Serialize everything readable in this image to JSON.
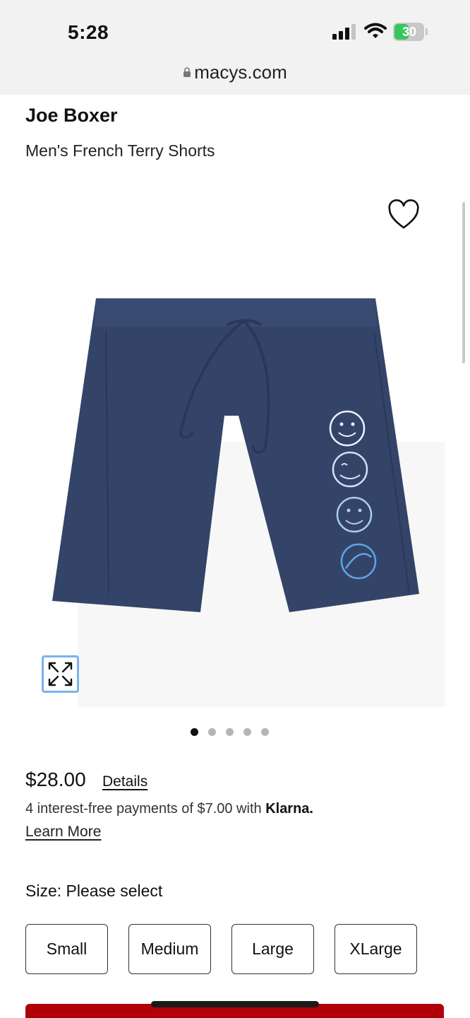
{
  "status_bar": {
    "time": "5:28",
    "battery": "30"
  },
  "browser": {
    "url": "macys.com"
  },
  "product": {
    "brand": "Joe Boxer",
    "name": "Men's French Terry Shorts",
    "price": "$28.00",
    "details_label": "Details",
    "klarna_text": "4 interest-free payments of $7.00 with ",
    "klarna_brand": "Klarna.",
    "learn_more_label": "Learn More"
  },
  "carousel": {
    "total_images": 5,
    "active_index": 0
  },
  "size": {
    "label": "Size: Please select",
    "options": [
      "Small",
      "Medium",
      "Large",
      "XLarge"
    ]
  },
  "colors": {
    "shorts": "#344468",
    "accent_blue": "#7ab3ec",
    "brand_red": "#b00008"
  },
  "icons": {
    "heart": "heart-icon",
    "expand": "expand-icon",
    "lock": "lock-icon"
  }
}
